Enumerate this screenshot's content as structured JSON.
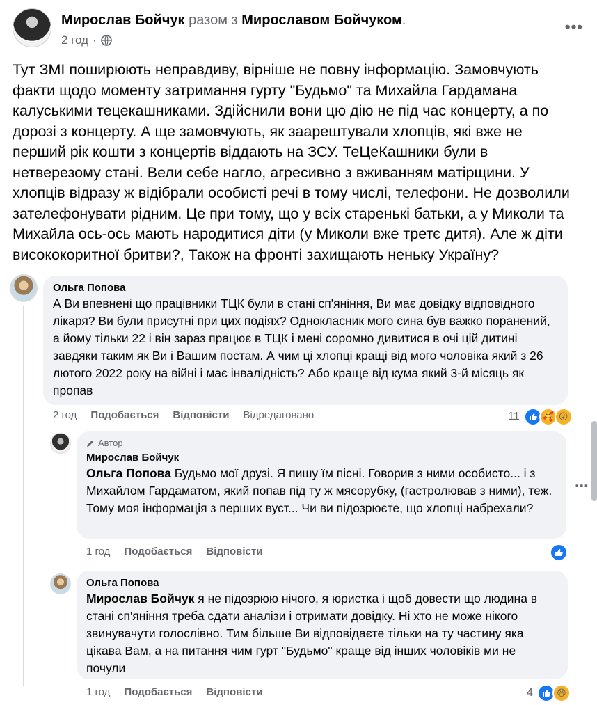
{
  "post": {
    "author": "Мирослав Бойчук",
    "with_text": "разом з",
    "with_author": "Мирославом Бойчуком",
    "with_suffix": ".",
    "time": "2 год",
    "dot": "·",
    "text": "Тут ЗМІ поширюють неправдиву, вірніше не повну інформацію. Замовчують факти щодо моменту затримання гурту \"Будьмо\" та Михайла Гардамана калуськими тецекашниками. Здійснили вони цю дію не під час концерту, а по дорозі з концерту. А ще замовчують, як заарештували хлопців, які вже не перший рік кошти з концертів віддають на ЗСУ. ТеЦеКашники були в нетверезому стані. Вели себе нагло, агресивно з вживанням матірщини. У хлопців відразу ж відібрали особисті речі в тому числі, телефони. Не дозволили зателефонувати рідним. Це при тому, що у всіх старенькі батьки, а у Миколи та Михайла ось-ось мають народитися діти (у Миколи вже третє дитя). Але ж діти висококоритної бритви?, Також на фронті захищають неньку Україну?",
    "more_icon": "more-dots-icon",
    "privacy_icon": "globe-icon"
  },
  "comments": [
    {
      "author": "Ольга Попова",
      "text": "А Ви впевнені що працівники ТЦК були в стані сп'яніння, Ви має довідку відповідного лікаря? Ви були присутні при цих подіях? Однокласник мого сина був важко поранений, а йому тільки 22 і він зараз працює в ТЦК і мені соромно дивитися в очі цій дитині завдяки таким як Ви і Вашим постам. А чим ці хлопці кращі від мого чоловіка який з 26 лютого 2022 року на війні і має інвалідність? Або краще від кума який 3-й місяць як пропав",
      "time": "2 год",
      "like": "Подобається",
      "reply": "Відповісти",
      "edited": "Відредаговано",
      "reaction_count": "11"
    },
    {
      "badge": "Автор",
      "author": "Мирослав Бойчук",
      "mention": "Ольга Попова",
      "text": " Будьмо мої друзі. Я пишу їм пісні. Говорив з ними особисто... і з Михайлом Гардаматом, який попав під ту ж мясорубку, (гастролював з ними), теж. Тому моя інформація з перших вуст... Чи ви підозрюєте, що хлопці набрехали?",
      "time": "1 год",
      "like": "Подобається",
      "reply": "Відповісти"
    },
    {
      "author": "Ольга Попова",
      "mention": "Мирослав Бойчук",
      "text": " я не підозрюю нічого, я юристка і щоб довести що людина в стані сп'яніння треба сдати аналізи і отримати довідку. Ні хто не може нікого звинувачути голослівно. Тим більше Ви відповідаєте тільки на ту частину яка цікава Вам, а на питання чим гурт \"Будьмо\" краще від інших чоловіків ми не почули",
      "time": "1 год",
      "like": "Подобається",
      "reply": "Відповісти",
      "reaction_count": "4"
    }
  ]
}
